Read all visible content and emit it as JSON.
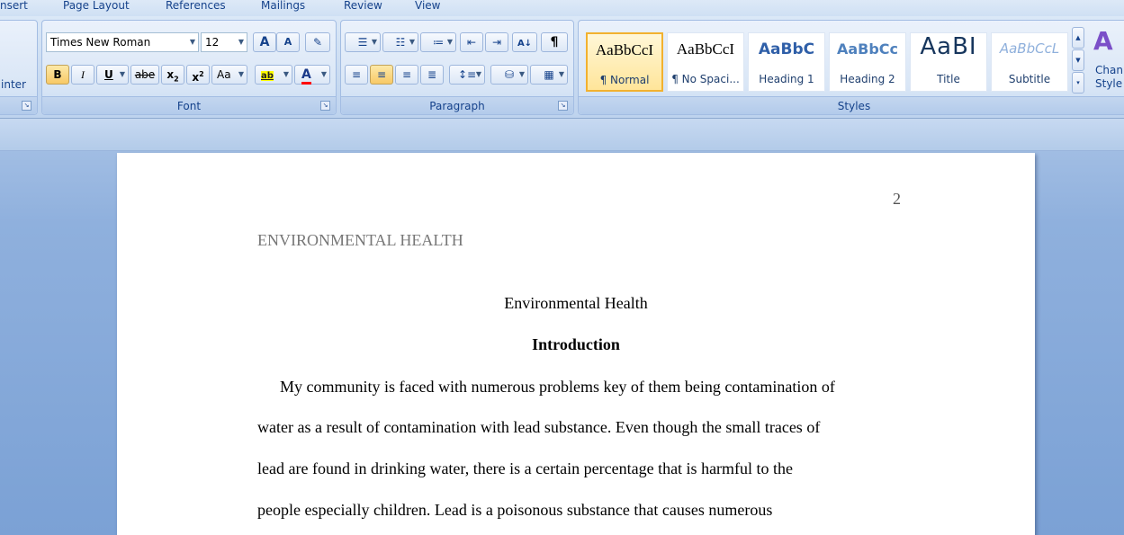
{
  "ribbon": {
    "tabs": [
      "nsert",
      "Page Layout",
      "References",
      "Mailings",
      "Review",
      "View"
    ],
    "clipboard": {
      "format_painter_label": "inter"
    },
    "font": {
      "label": "Font",
      "font_name": "Times New Roman",
      "font_size": "12",
      "grow_label": "A",
      "shrink_label": "A",
      "bold_label": "B",
      "italic_label": "I",
      "underline_label": "U",
      "strike_label": "abe",
      "subscript_label": "x",
      "superscript_label": "x",
      "change_case_label": "Aa",
      "highlight_label": "ab",
      "font_color_label": "A",
      "highlight_color": "#ffff00",
      "font_color": "#ff0000"
    },
    "paragraph": {
      "label": "Paragraph",
      "pilcrow_label": "¶"
    },
    "styles": {
      "label": "Styles",
      "items": [
        {
          "sample": "AaBbCcI",
          "name": "¶ Normal",
          "selected": true
        },
        {
          "sample": "AaBbCcI",
          "name": "¶ No Spaci...",
          "selected": false
        },
        {
          "sample": "AaBbC",
          "name": "Heading 1",
          "selected": false
        },
        {
          "sample": "AaBbCc",
          "name": "Heading 2",
          "selected": false
        },
        {
          "sample": "AaBI",
          "name": "Title",
          "selected": false
        },
        {
          "sample": "AaBbCcL",
          "name": "Subtitle",
          "selected": false
        }
      ],
      "change_styles_label_1": "Chan",
      "change_styles_label_2": "Style"
    }
  },
  "document": {
    "page_number": "2",
    "running_head": "ENVIRONMENTAL HEALTH",
    "title": "Environmental Health",
    "heading": "Introduction",
    "lines": [
      "My community is faced with numerous problems key of them being contamination of",
      "water as a result of contamination with lead substance. Even though the small traces of",
      "lead are found in drinking water, there is a certain percentage that is harmful to the",
      "people especially children. Lead is a poisonous substance that causes numerous"
    ]
  }
}
